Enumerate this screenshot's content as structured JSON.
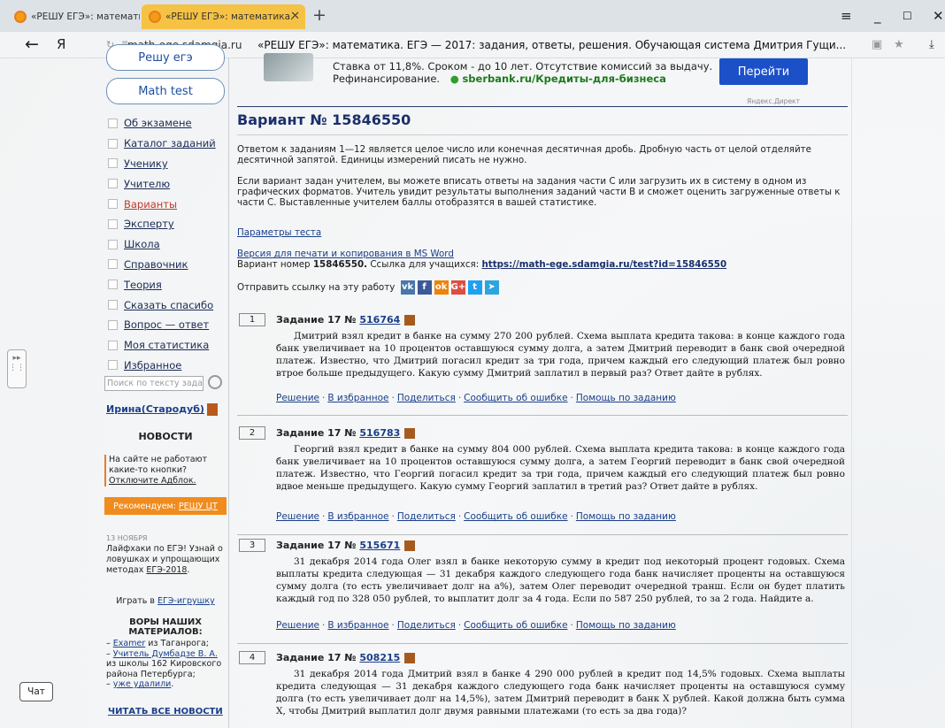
{
  "browser": {
    "tabs": [
      {
        "label": "«РЕШУ ЕГЭ»: математика. Е",
        "active": false
      },
      {
        "label": "«РЕШУ ЕГЭ»: математика.",
        "active": true
      }
    ],
    "new_tab": "+",
    "yandex": "Я",
    "host": "math-ege.sdamgia.ru",
    "page_title": "«РЕШУ ЕГЭ»: математика. ЕГЭ — 2017: задания, ответы, решения. Обучающая система Дмитрия Гущи...",
    "icons": [
      "back-arrow-icon",
      "reload-icon",
      "menu-icon",
      "minimize-icon",
      "maximize-icon",
      "close-icon",
      "star-icon",
      "download-icon"
    ]
  },
  "sidebar": {
    "top_button": "Решу егэ",
    "math_test": "Math test",
    "menu": [
      "Об экзамене",
      "Каталог заданий",
      "Ученику",
      "Учителю",
      "Варианты",
      "Эксперту",
      "Школа",
      "Справочник",
      "Теория",
      "Сказать спасибо",
      "Вопрос — ответ",
      "Моя статистика",
      "Избранное"
    ],
    "active_item": "Варианты",
    "search_placeholder": "Поиск по тексту задания",
    "user": "Ирина(Стародуб)",
    "news_title": "НОВОСТИ",
    "notice_text": "На сайте не работают какие-то кнопки?",
    "notice_link": "Отключите Адблок.",
    "recommend": "Рекомендуем:",
    "recommend_link": "РЕШУ ЦТ",
    "news_date": "13 НОЯБРЯ",
    "news_text": "Лайфхаки по ЕГЭ! Узнай о ловушках и упрощающих методах",
    "news_link": "ЕГЭ-2018",
    "play_prefix": "Играть в",
    "play_link": "ЕГЭ-игрушку",
    "thieves_title": "ВОРЫ НАШИХ МАТЕРИАЛОВ:",
    "thieves": [
      {
        "link": "Examer",
        "text": " из Таганрога;"
      },
      {
        "link": "Учитель Думбадзе В. А.",
        "text": " из школы 162 Кировского района Петербурга;"
      },
      {
        "link": "уже удалили",
        "text": "."
      }
    ],
    "read_all": "ЧИТАТЬ ВСЕ НОВОСТИ"
  },
  "ad": {
    "line1": "Ставка от 11,8%. Сроком - до 10 лет. Отсутствие комиссий за выдачу.",
    "line2": "Рефинансирование.",
    "link": "sberbank.ru/Кредиты-для-бизнеса",
    "button": "Перейти",
    "source": "Яндекс.Директ"
  },
  "main": {
    "title": "Вариант № 15846550",
    "intro1": "Ответом к заданиям 1—12 является целое число или конечная десятичная дробь. Дробную часть от целой отделяйте десятичной запятой. Единицы измерений писать не нужно.",
    "intro2": "Если вариант задан учителем, вы можете вписать ответы на задания части С или загрузить их в систему в одном из графических форматов. Учитель увидит результаты выполнения заданий части В и сможет оценить загруженные ответы к части С. Выставленные учителем баллы отобразятся в вашей статистике.",
    "params_link": "Параметры теста",
    "print_link": "Версия для печати и копирования в MS Word",
    "variant_prefix": "Вариант номер ",
    "variant_number": "15846550.",
    "students_link_prefix": " Ссылка для учащихся: ",
    "students_link": "https://math-ege.sdamgia.ru/test?id=15846550",
    "share_label": "Отправить ссылку на эту работу",
    "share_icons": [
      "vk-icon",
      "facebook-icon",
      "odnoklassniki-icon",
      "googleplus-icon",
      "twitter-icon",
      "telegram-icon"
    ]
  },
  "task_links": {
    "solution": "Решение",
    "favorite": "В избранное",
    "share": "Поделиться",
    "report": "Сообщить об ошибке",
    "help": "Помощь по заданию"
  },
  "tasks": [
    {
      "num": "1",
      "title": "Задание 17 №",
      "id": "516764",
      "text": "Дмитрий взял кредит в банке на сумму 270 200 рублей. Схема выплата кредита такова: в конце каждого года банк увеличивает на 10 процентов оставшуюся сумму долга, а затем Дмитрий переводит в банк свой очередной платеж. Известно, что Дмитрий погасил кредит за три года, причем каждый его следующий платеж был ровно втрое больше предыдущего. Какую сумму Дмитрий заплатил в первый раз? Ответ дайте в рублях."
    },
    {
      "num": "2",
      "title": "Задание 17 №",
      "id": "516783",
      "text": "Георгий взял кредит в банке на сумму 804 000 рублей. Схема выплата кредита такова: в конце каждого года банк увеличивает на 10 процентов оставшуюся сумму долга, а затем Георгий переводит в банк свой очередной платеж. Известно, что Георгий погасил кредит за три года, причем каждый его следующий платеж был ровно вдвое меньше предыдущего. Какую сумму Георгий заплатил в третий раз? Ответ дайте в рублях."
    },
    {
      "num": "3",
      "title": "Задание 17 №",
      "id": "515671",
      "text": "31 декабря 2014 года Олег взял в банке некоторую сумму в кредит под некоторый процент годовых. Схема выплаты кредита следующая — 31 декабря каждого следующего года банк начисляет проценты на оставшуюся сумму долга (то есть увеличивает долг на a%), затем Олег переводит очередной транш. Если он будет платить каждый год по 328 050 рублей, то выплатит долг за 4 года. Если по 587 250 рублей, то за 2 года. Найдите a."
    },
    {
      "num": "4",
      "title": "Задание 17 №",
      "id": "508215",
      "text": "31 декабря 2014 года Дмитрий взял в банке 4 290 000 рублей в кредит под 14,5% годовых. Схема выплаты кредита следующая — 31 декабря каждого следующего года банк начисляет проценты на оставшуюся сумму долга (то есть увеличивает долг на 14,5%), затем Дмитрий переводит в банк X рублей. Какой должна быть сумма X, чтобы Дмитрий выплатил долг двумя равными платежами (то есть за два года)?"
    }
  ],
  "chat": "Чат"
}
